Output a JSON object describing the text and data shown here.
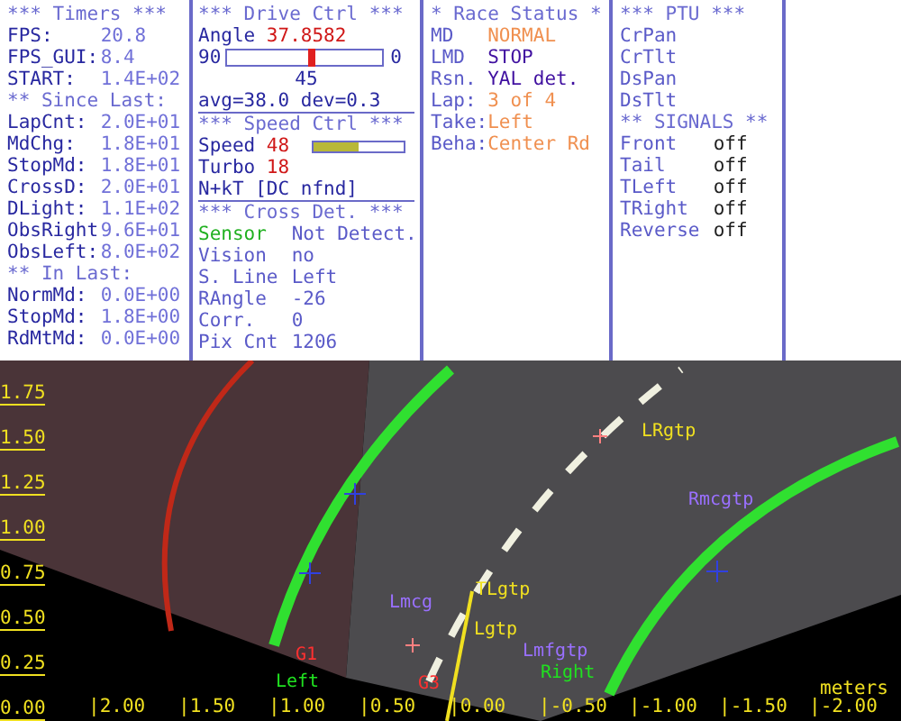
{
  "timers": [
    {
      "kind": "heading",
      "label": "*** Timers ***"
    },
    {
      "kind": "row",
      "label": "FPS:",
      "value": "20.8"
    },
    {
      "kind": "row",
      "label": "FPS_GUI:",
      "value": "8.4"
    },
    {
      "kind": "row",
      "label": "START:",
      "value": "1.4E+02"
    },
    {
      "kind": "heading",
      "label": "** Since Last:"
    },
    {
      "kind": "row",
      "label": "LapCnt:",
      "value": "2.0E+01"
    },
    {
      "kind": "row",
      "label": "MdChg:",
      "value": "1.8E+01"
    },
    {
      "kind": "row",
      "label": "StopMd:",
      "value": "1.8E+01"
    },
    {
      "kind": "row",
      "label": "CrossD:",
      "value": "2.0E+01"
    },
    {
      "kind": "row",
      "label": "DLight:",
      "value": "1.1E+02"
    },
    {
      "kind": "row",
      "label": "ObsRight",
      "value": "9.6E+01"
    },
    {
      "kind": "row",
      "label": "ObsLeft:",
      "value": "8.0E+02"
    },
    {
      "kind": "heading",
      "label": "** In Last:"
    },
    {
      "kind": "row",
      "label": "NormMd:",
      "value": "0.0E+00"
    },
    {
      "kind": "row",
      "label": "StopMd:",
      "value": "1.8E+00"
    },
    {
      "kind": "row",
      "label": "RdMtMd:",
      "value": "0.0E+00"
    }
  ],
  "drive_ctrl": {
    "title": "*** Drive Ctrl ***",
    "angle_label": "Angle",
    "angle_value": "37.8582",
    "min_label": "90",
    "max_label": "0",
    "mid_label": "45",
    "level": 0.55,
    "stats": "avg=38.0 dev=0.3"
  },
  "speed_ctrl": {
    "title": "*** Speed Ctrl ***",
    "speed_label": "Speed",
    "speed_value": "48",
    "level": 0.5,
    "turbo_label": "Turbo",
    "turbo_value": "18",
    "status": "N+kT [DC nfnd]"
  },
  "cross_det": {
    "title": "*** Cross Det. ***",
    "rows": [
      {
        "label": "Sensor",
        "value": "Not Detect.",
        "color": "#20b020"
      },
      {
        "label": "Vision",
        "value": "no"
      },
      {
        "label": "S. Line",
        "value": "Left"
      },
      {
        "label": "RAngle",
        "value": "-26"
      },
      {
        "label": "Corr.",
        "value": "0"
      },
      {
        "label": "Pix Cnt",
        "value": "1206"
      }
    ]
  },
  "race_status": {
    "title": "* Race Status *",
    "rows": [
      {
        "label": "MD",
        "value": "NORMAL",
        "color": "#f09050"
      },
      {
        "label": "LMD",
        "value": "STOP",
        "color": "#4010a0"
      },
      {
        "label": "Rsn.",
        "value": "YAL det.",
        "color": "#4010a0"
      },
      {
        "label": "Lap:",
        "value": "3 of 4",
        "color": "#f09050"
      },
      {
        "label": "Take:",
        "value": "Left",
        "color": "#f09050"
      },
      {
        "label": "Beha:",
        "value": "Center Rd",
        "color": "#f09050"
      }
    ]
  },
  "ptu": {
    "title": "*** PTU ***",
    "rows": [
      "CrPan",
      "CrTlt",
      "DsPan",
      "DsTlt"
    ]
  },
  "signals": {
    "title": "** SIGNALS **",
    "rows": [
      {
        "label": "Front",
        "value": "off"
      },
      {
        "label": "Tail",
        "value": "off"
      },
      {
        "label": "TLeft",
        "value": "off"
      },
      {
        "label": "TRight",
        "value": "off"
      },
      {
        "label": "Reverse",
        "value": "off"
      }
    ]
  },
  "camera": {
    "y_axis": [
      "1.75",
      "1.50",
      "1.25",
      "1.00",
      "0.75",
      "0.50",
      "0.25",
      "0.00"
    ],
    "x_axis": [
      "|2.00",
      "|1.50",
      "|1.00",
      "|0.50",
      "|0.00",
      "|-0.50",
      "|-1.00",
      "|-1.50",
      "|-2.00"
    ],
    "unit": "meters",
    "markers": [
      {
        "text": "LRgtp",
        "color": "#f0e020"
      },
      {
        "text": "Rmcgtp",
        "color": "#9a70ff"
      },
      {
        "text": "TLgtp",
        "color": "#f0e020"
      },
      {
        "text": "Lmcg",
        "color": "#9a70ff"
      },
      {
        "text": "Lgtp",
        "color": "#f0e020"
      },
      {
        "text": "G1",
        "color": "#ff3030"
      },
      {
        "text": "Left",
        "color": "#20e020"
      },
      {
        "text": "G3",
        "color": "#ff3030"
      },
      {
        "text": "Lmfgtp",
        "color": "#9a70ff"
      },
      {
        "text": "Right",
        "color": "#20e020"
      }
    ]
  }
}
